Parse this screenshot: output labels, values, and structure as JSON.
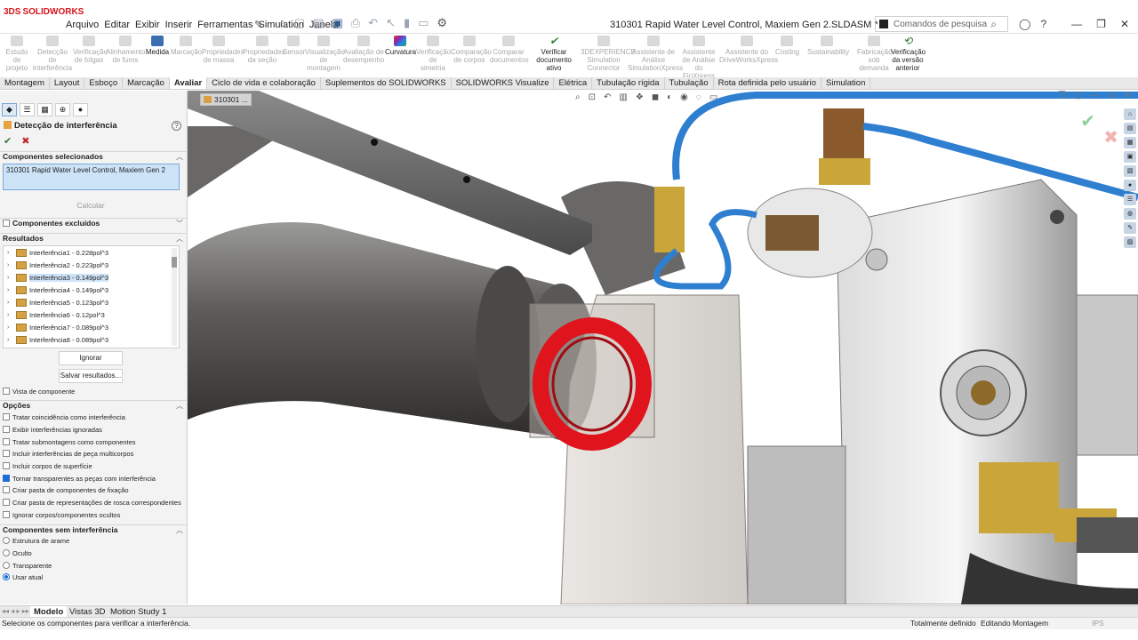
{
  "app": {
    "logo": "SOLIDWORKS",
    "document_title": "310301 Rapid Water Level Control, Maxiem Gen 2.SLDASM *"
  },
  "menu": [
    "Arquivo",
    "Editar",
    "Exibir",
    "Inserir",
    "Ferramentas",
    "Simulation",
    "Janela"
  ],
  "search": {
    "placeholder": "Comandos de pesquisa"
  },
  "ribbon": [
    {
      "label": "Estudo de projeto",
      "enabled": false
    },
    {
      "label": "Detecção de interferência",
      "enabled": false
    },
    {
      "label": "Verificação de folgas",
      "enabled": false
    },
    {
      "label": "Alinhamento de furos",
      "enabled": false
    },
    {
      "label": "Medida",
      "enabled": true
    },
    {
      "label": "Marcação",
      "enabled": false
    },
    {
      "label": "Propriedades de massa",
      "enabled": false
    },
    {
      "label": "Propriedades da seção",
      "enabled": false
    },
    {
      "label": "Sensor",
      "enabled": false
    },
    {
      "label": "Visualização de montagem",
      "enabled": false
    },
    {
      "label": "Avaliação de desempenho",
      "enabled": false
    },
    {
      "label": "Curvatura",
      "enabled": true
    },
    {
      "label": "Verificação de simetria",
      "enabled": false
    },
    {
      "label": "Comparação de corpos",
      "enabled": false
    },
    {
      "label": "Comparar documentos",
      "enabled": false
    },
    {
      "label": "Verificar documento ativo",
      "enabled": true
    },
    {
      "label": "3DEXPERIENCE Simulation Connector",
      "enabled": false
    },
    {
      "label": "Assistente de Análise SimulationXpress",
      "enabled": false
    },
    {
      "label": "Assistente de Análise do FloXpress",
      "enabled": false
    },
    {
      "label": "Assistente do DriveWorksXpress",
      "enabled": false
    },
    {
      "label": "Costing",
      "enabled": false
    },
    {
      "label": "Sustainability",
      "enabled": false
    },
    {
      "label": "Fabricação sob demanda",
      "enabled": false
    },
    {
      "label": "Verificação da versão anterior",
      "enabled": true
    }
  ],
  "tabs": [
    "Montagem",
    "Layout",
    "Esboço",
    "Marcação",
    "Avaliar",
    "Ciclo de vida e colaboração",
    "Suplementos do SOLIDWORKS",
    "SOLIDWORKS Visualize",
    "Elétrica",
    "Tubulação rígida",
    "Tubulação",
    "Rota definida pelo usuário",
    "Simulation"
  ],
  "active_tab": "Avaliar",
  "panel": {
    "title": "Detecção de interferência",
    "selected_section": "Componentes selecionados",
    "selected_value": "310301 Rapid Water Level Control, Maxiem Gen 2",
    "calc_button": "Calcular",
    "excluded_section": "Componentes excluídos",
    "results_section": "Resultados",
    "results": [
      "Interferência1 - 0.228pol^3",
      "Interferência2 - 0.223pol^3",
      "Interferência3 - 0.149pol^3",
      "Interferência4 - 0.149pol^3",
      "Interferência5 - 0.123pol^3",
      "Interferência6 - 0.12pol^3",
      "Interferência7 - 0.089pol^3",
      "Interferência8 - 0.089pol^3"
    ],
    "selected_result_index": 2,
    "ignore_button": "Ignorar",
    "save_button": "Salvar resultados...",
    "component_view": "Vista de componente",
    "options_section": "Opções",
    "options": [
      {
        "label": "Tratar coincidência como interferência",
        "checked": false
      },
      {
        "label": "Exibir interferências ignoradas",
        "checked": false
      },
      {
        "label": "Tratar submontagens como componentes",
        "checked": false
      },
      {
        "label": "Incluir interferências de peça multicorpos",
        "checked": false
      },
      {
        "label": "Incluir corpos de superfície",
        "checked": false
      },
      {
        "label": "Tornar transparentes as peças com interferência",
        "checked": true
      },
      {
        "label": "Criar pasta de componentes de fixação",
        "checked": false
      },
      {
        "label": "Criar pasta de representações de rosca correspondentes",
        "checked": false
      },
      {
        "label": "Ignorar corpos/componentes ocultos",
        "checked": false
      }
    ],
    "noninterf_section": "Componentes sem interferência",
    "display_modes": [
      {
        "label": "Estrutura de arame",
        "selected": false
      },
      {
        "label": "Oculto",
        "selected": false
      },
      {
        "label": "Transparente",
        "selected": false
      },
      {
        "label": "Usar atual",
        "selected": true
      }
    ]
  },
  "viewport": {
    "breadcrumb": "310301 ...",
    "interference_color": "#e0141c"
  },
  "bottom_tabs": [
    "Modelo",
    "Vistas 3D",
    "Motion Study 1"
  ],
  "status": {
    "message": "Selecione os componentes para verificar a interferência.",
    "state1": "Totalmente definido",
    "state2": "Editando Montagem",
    "units": "IPS"
  }
}
